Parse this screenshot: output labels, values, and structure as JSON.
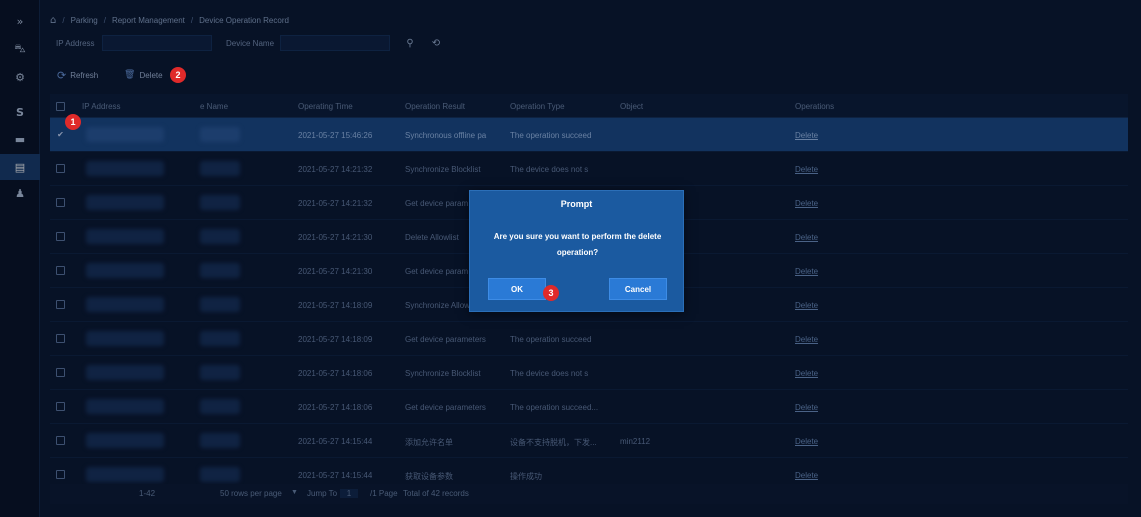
{
  "sidebar": {
    "icons": [
      {
        "name": "expand-icon",
        "glyph": "»"
      },
      {
        "name": "vehicle-icon",
        "glyph": "⛍"
      },
      {
        "name": "settings-icon",
        "glyph": "⚙"
      },
      {
        "name": "payment-icon",
        "glyph": "S"
      },
      {
        "name": "car-icon",
        "glyph": "▬"
      },
      {
        "name": "report-icon",
        "glyph": "▤"
      },
      {
        "name": "user-icon",
        "glyph": "♟"
      }
    ]
  },
  "breadcrumb": {
    "home": "⌂",
    "items": [
      "Parking",
      "Report Management",
      "Device Operation Record"
    ]
  },
  "filters": {
    "ip_label": "IP Address",
    "device_name_label": "Device Name",
    "search_icon": "⚲",
    "reset_icon": "⟲"
  },
  "toolbar": {
    "refresh_label": "Refresh",
    "refresh_icon": "⟳",
    "delete_label": "Delete",
    "delete_icon": "🗑"
  },
  "markers": [
    "1",
    "2",
    "3"
  ],
  "table": {
    "headers": {
      "ip": "IP Address",
      "device_name": "e Name",
      "time": "Operating Time",
      "result": "Operation Result",
      "type": "Operation Type",
      "object": "Object",
      "operations": "Operations"
    },
    "rows": [
      {
        "time": "2021-05-27 15:46:26",
        "result": "Synchronous offline pa",
        "type": "The operation succeed",
        "object": "",
        "op": "Delete",
        "selected": true
      },
      {
        "time": "2021-05-27 14:21:32",
        "result": "Synchronize Blocklist",
        "type": "The device does not s",
        "object": "",
        "op": "Delete",
        "selected": false
      },
      {
        "time": "2021-05-27 14:21:32",
        "result": "Get device param",
        "type": "",
        "object": "",
        "op": "Delete",
        "selected": false
      },
      {
        "time": "2021-05-27 14:21:30",
        "result": "Delete Allowlist",
        "type": "",
        "object": "",
        "op": "Delete",
        "selected": false
      },
      {
        "time": "2021-05-27 14:21:30",
        "result": "Get device param",
        "type": "",
        "object": "",
        "op": "Delete",
        "selected": false
      },
      {
        "time": "2021-05-27 14:18:09",
        "result": "Synchronize Allow",
        "type": "",
        "object": "",
        "op": "Delete",
        "selected": false
      },
      {
        "time": "2021-05-27 14:18:09",
        "result": "Get device parameters",
        "type": "The operation succeed",
        "object": "",
        "op": "Delete",
        "selected": false
      },
      {
        "time": "2021-05-27 14:18:06",
        "result": "Synchronize Blocklist",
        "type": "The device does not s",
        "object": "",
        "op": "Delete",
        "selected": false
      },
      {
        "time": "2021-05-27 14:18:06",
        "result": "Get device parameters",
        "type": "The operation succeed...",
        "object": "",
        "op": "Delete",
        "selected": false
      },
      {
        "time": "2021-05-27 14:15:44",
        "result": "添加允许名单",
        "type": "设备不支持脱机，下发...",
        "object": "min2112",
        "op": "Delete",
        "selected": false
      },
      {
        "time": "2021-05-27 14:15:44",
        "result": "获取设备参数",
        "type": "操作成功",
        "object": "",
        "op": "Delete",
        "selected": false
      }
    ]
  },
  "modal": {
    "title": "Prompt",
    "message": "Are you sure you want to perform the delete operation?",
    "ok_label": "OK",
    "cancel_label": "Cancel"
  },
  "footer": {
    "range": "1-42",
    "rows_per_page": "50 rows per page",
    "jump_label": "Jump To",
    "jump_value": "1",
    "page_info": "/1 Page",
    "total": "Total of 42 records"
  },
  "colors": {
    "background": "#0a1730",
    "selected_row": "#1b4a87",
    "modal": "#1b5aa0",
    "button": "#2a7ad6",
    "marker": "#e02a2a"
  }
}
